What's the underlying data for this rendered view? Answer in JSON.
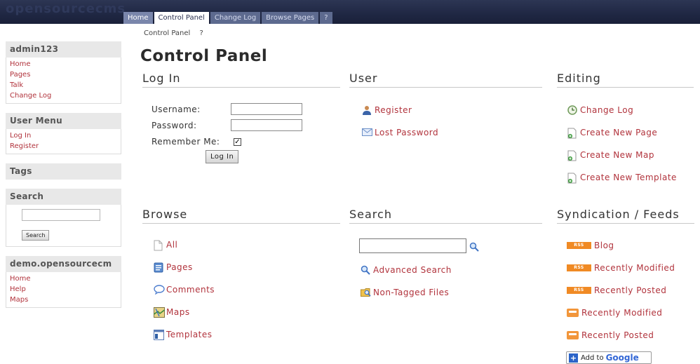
{
  "brand": {
    "ghost_logo": "opensourcecms"
  },
  "top_tabs": [
    {
      "label": "Home"
    },
    {
      "label": "Control Panel"
    },
    {
      "label": "Change Log"
    },
    {
      "label": "Browse Pages"
    },
    {
      "label": "?"
    }
  ],
  "breadcrumb": {
    "current": "Control Panel",
    "help": "?"
  },
  "page_title": "Control Panel",
  "sidebar": {
    "user_box": {
      "title": "admin123",
      "items": [
        {
          "label": "Home"
        },
        {
          "label": "Pages"
        },
        {
          "label": "Talk"
        },
        {
          "label": "Change Log"
        }
      ]
    },
    "user_menu": {
      "title": "User Menu",
      "items": [
        {
          "label": "Log In"
        },
        {
          "label": "Register"
        }
      ]
    },
    "tags": {
      "title": "Tags"
    },
    "search": {
      "title": "Search",
      "value": "",
      "button": "Search"
    },
    "site_box": {
      "title": "demo.opensourcecm",
      "items": [
        {
          "label": "Home"
        },
        {
          "label": "Help"
        },
        {
          "label": "Maps"
        }
      ]
    }
  },
  "login": {
    "heading": "Log In",
    "username_label": "Username:",
    "username_value": "",
    "password_label": "Password:",
    "password_value": "",
    "remember_label": "Remember Me:",
    "remember_checked": true,
    "checkbox_mark": "✓",
    "button": "Log In"
  },
  "user": {
    "heading": "User",
    "links": [
      {
        "label": "Register",
        "icon": "user-icon"
      },
      {
        "label": "Lost Password",
        "icon": "envelope-icon"
      }
    ]
  },
  "editing": {
    "heading": "Editing",
    "links": [
      {
        "label": "Change Log",
        "icon": "clock-icon"
      },
      {
        "label": "Create New Page",
        "icon": "new-page-icon"
      },
      {
        "label": "Create New Map",
        "icon": "new-page-icon"
      },
      {
        "label": "Create New Template",
        "icon": "new-page-icon"
      }
    ]
  },
  "browse": {
    "heading": "Browse",
    "links": [
      {
        "label": "All",
        "icon": "blank-page-icon"
      },
      {
        "label": "Pages",
        "icon": "page-icon"
      },
      {
        "label": "Comments",
        "icon": "comment-icon"
      },
      {
        "label": "Maps",
        "icon": "map-icon"
      },
      {
        "label": "Templates",
        "icon": "template-icon"
      }
    ]
  },
  "search_section": {
    "heading": "Search",
    "input_value": "",
    "links": [
      {
        "label": "Advanced Search",
        "icon": "magnifier-icon"
      },
      {
        "label": "Non-Tagged Files",
        "icon": "folder-search-icon"
      }
    ]
  },
  "syndication": {
    "heading": "Syndication / Feeds",
    "rss_badge": "RSS",
    "links": [
      {
        "label": "Blog",
        "icon": "rss-badge"
      },
      {
        "label": "Recently Modified",
        "icon": "rss-badge"
      },
      {
        "label": "Recently Posted",
        "icon": "rss-badge"
      },
      {
        "label": "Recently Modified",
        "icon": "feed-icon"
      },
      {
        "label": "Recently Posted",
        "icon": "feed-icon"
      }
    ],
    "google": {
      "prefix": "Add to",
      "brand": "Google"
    }
  },
  "colors": {
    "topbar": "#1f2743",
    "link": "#b1333c",
    "tab_active": "#ffffff",
    "tab_inactive": "#5d6a8f"
  }
}
